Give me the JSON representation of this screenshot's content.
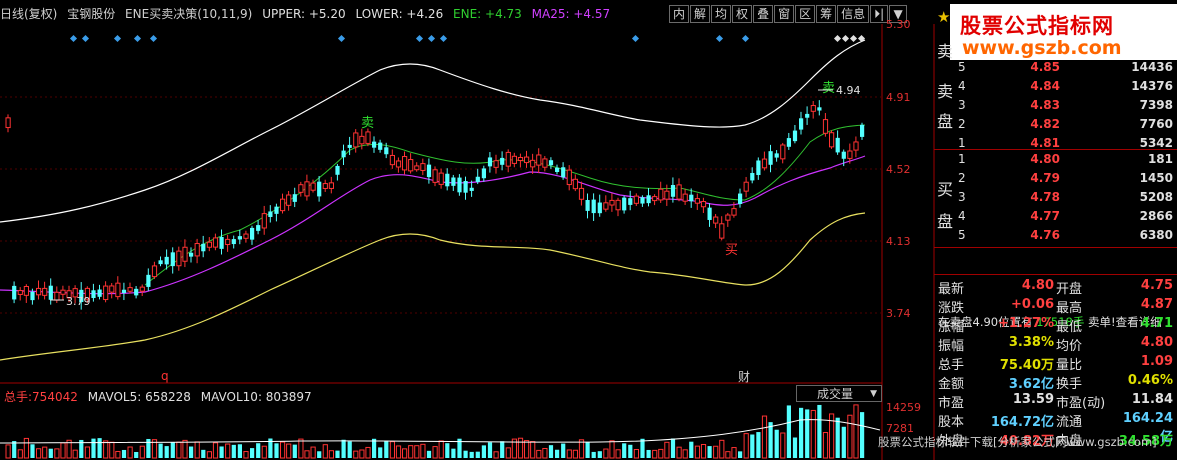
{
  "header": {
    "period": "日线(复权)",
    "stock_name": "宝钢股份",
    "indicator": "ENE买卖决策(10,11,9)",
    "upper": "UPPER: +5.20",
    "lower": "LOWER: +4.26",
    "ene": "ENE: +4.73",
    "ma25": "MA25: +4.57"
  },
  "toolbar": {
    "items": [
      "内",
      "解",
      "均",
      "权",
      "叠",
      "窗",
      "区",
      "筹",
      "信息"
    ],
    "nav_icon": "⏵|",
    "menu_icon": "▼"
  },
  "price_axis": [
    "5.30",
    "4.91",
    "4.52",
    "4.13",
    "3.74"
  ],
  "volume_axis": [
    "14259",
    "7281"
  ],
  "annotations": {
    "sell_mark": "卖",
    "buy_mark": "买",
    "high_price": "4.94",
    "low_price": "3.79",
    "bottom_q": "q",
    "bottom_cai": "财"
  },
  "volume_panel": {
    "total_label": "总手:",
    "total_value": "754042",
    "mavol5": "MAVOL5: 658228",
    "mavol10": "MAVOL10: 803897",
    "selector": "成交量"
  },
  "watermark": {
    "title": "股票公式指标网",
    "url": "www.gszb.com"
  },
  "order_book": {
    "sell_label_1": "卖",
    "sell_label_2": "盘",
    "buy_label_1": "买",
    "buy_label_2": "盘",
    "asks": [
      {
        "level": "5",
        "price": "4.85",
        "volume": "14436"
      },
      {
        "level": "4",
        "price": "4.84",
        "volume": "14376"
      },
      {
        "level": "3",
        "price": "4.83",
        "volume": "7398"
      },
      {
        "level": "2",
        "price": "4.82",
        "volume": "7760"
      },
      {
        "level": "1",
        "price": "4.81",
        "volume": "5342"
      }
    ],
    "bids": [
      {
        "level": "1",
        "price": "4.80",
        "volume": "181"
      },
      {
        "level": "2",
        "price": "4.79",
        "volume": "1450"
      },
      {
        "level": "3",
        "price": "4.78",
        "volume": "5208"
      },
      {
        "level": "4",
        "price": "4.77",
        "volume": "2866"
      },
      {
        "level": "5",
        "price": "4.76",
        "volume": "6380"
      }
    ],
    "message_prefix": "在卖盘4.90位置有",
    "message_amount": "17518手",
    "message_suffix": "卖单!查看详细"
  },
  "stats": [
    {
      "k1": "最新",
      "v1": "4.80",
      "c1": "#ff4040",
      "k2": "开盘",
      "v2": "4.75",
      "c2": "#ff4040"
    },
    {
      "k1": "涨跌",
      "v1": "+0.06",
      "c1": "#ff4040",
      "k2": "最高",
      "v2": "4.87",
      "c2": "#ff4040"
    },
    {
      "k1": "涨幅",
      "v1": "+1.27%",
      "c1": "#ff4040",
      "k2": "最低",
      "v2": "4.71",
      "c2": "#30e030"
    },
    {
      "k1": "振幅",
      "v1": "3.38%",
      "c1": "#e0e000",
      "k2": "均价",
      "v2": "4.80",
      "c2": "#ff4040"
    },
    {
      "k1": "总手",
      "v1": "75.40万",
      "c1": "#e0e000",
      "k2": "量比",
      "v2": "1.09",
      "c2": "#ff4040"
    },
    {
      "k1": "金额",
      "v1": "3.62亿",
      "c1": "#5fd0ff",
      "k2": "换手",
      "v2": "0.46%",
      "c2": "#e0e000"
    },
    {
      "k1": "市盈",
      "v1": "13.59",
      "c1": "#e0e0e0",
      "k2": "市盈(动)",
      "v2": "11.84",
      "c2": "#e0e0e0"
    },
    {
      "k1": "股本",
      "v1": "164.72亿",
      "c1": "#5fd0ff",
      "k2": "流通",
      "v2": "164.24亿",
      "c2": "#5fd0ff"
    },
    {
      "k1": "外盘",
      "v1": "40.82万",
      "c1": "#ff4040",
      "k2": "内盘",
      "v2": "34.58万",
      "c2": "#30e030"
    }
  ],
  "footer": "股票公式指标软件下载[分析家公式网www.gszb.com]",
  "colors": {
    "up": "#ff3333",
    "down": "#54ffff",
    "upper_band": "#ffffff",
    "lower_band": "#e8e060",
    "ene_line": "#ff00ff",
    "ma25_line": "#30c030",
    "signal": "#3a9ce8"
  }
}
